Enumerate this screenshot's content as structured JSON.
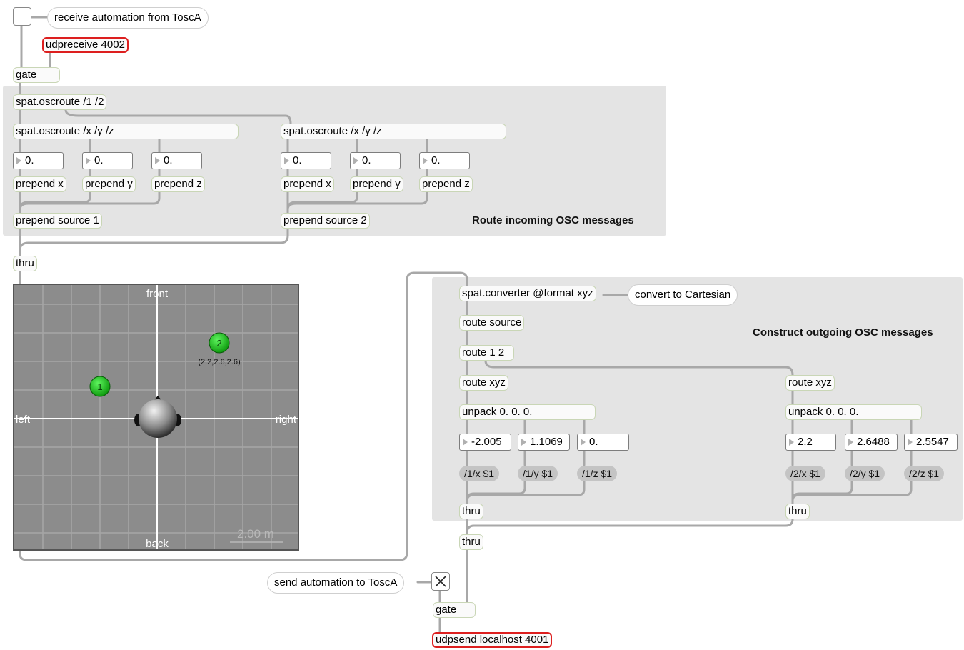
{
  "top": {
    "comment_receive": "receive automation from ToscA",
    "udpreceive": "udpreceive 4002",
    "gate": "gate"
  },
  "route_panel": {
    "label": "Route incoming OSC messages",
    "oscroute_root": "spat.oscroute /1 /2",
    "source1": {
      "oscroute": "spat.oscroute /x /y /z",
      "numbers": [
        "0.",
        "0.",
        "0."
      ],
      "prepends": [
        "prepend x",
        "prepend y",
        "prepend z"
      ],
      "prepend_source": "prepend source 1"
    },
    "source2": {
      "oscroute": "spat.oscroute /x /y /z",
      "numbers": [
        "0.",
        "0.",
        "0."
      ],
      "prepends": [
        "prepend x",
        "prepend y",
        "prepend z"
      ],
      "prepend_source": "prepend source 2"
    }
  },
  "thru_left": "thru",
  "viewer": {
    "front": "front",
    "back": "back",
    "left": "left",
    "right": "right",
    "scale": "2.00 m",
    "source1_label": "1",
    "source2_label": "2",
    "source2_coords": "(2.2,2.6,2.6)",
    "colors": {
      "background": "#8c8c8c",
      "grid": "#a6a6a6",
      "axes": "#ffffff",
      "source": "#1fc21f"
    }
  },
  "construct_panel": {
    "label": "Construct outgoing OSC messages",
    "converter": "spat.converter @format xyz",
    "converter_comment": "convert to Cartesian",
    "route_source": "route source",
    "route12": "route 1 2",
    "source1": {
      "route_xyz": "route xyz",
      "unpack": "unpack 0. 0. 0.",
      "numbers": [
        "-2.005",
        "1.1069",
        "0."
      ],
      "messages": [
        "/1/x $1",
        "/1/y $1",
        "/1/z $1"
      ],
      "thru": "thru"
    },
    "source2": {
      "route_xyz": "route xyz",
      "unpack": "unpack 0. 0. 0.",
      "numbers": [
        "2.2",
        "2.6488",
        "2.5547"
      ],
      "messages": [
        "/2/x $1",
        "/2/y $1",
        "/2/z $1"
      ],
      "thru": "thru"
    }
  },
  "bottom": {
    "thru": "thru",
    "comment_send": "send automation to ToscA",
    "send_toggle_checked": true,
    "gate": "gate",
    "udpsend": "udpsend localhost 4001"
  }
}
